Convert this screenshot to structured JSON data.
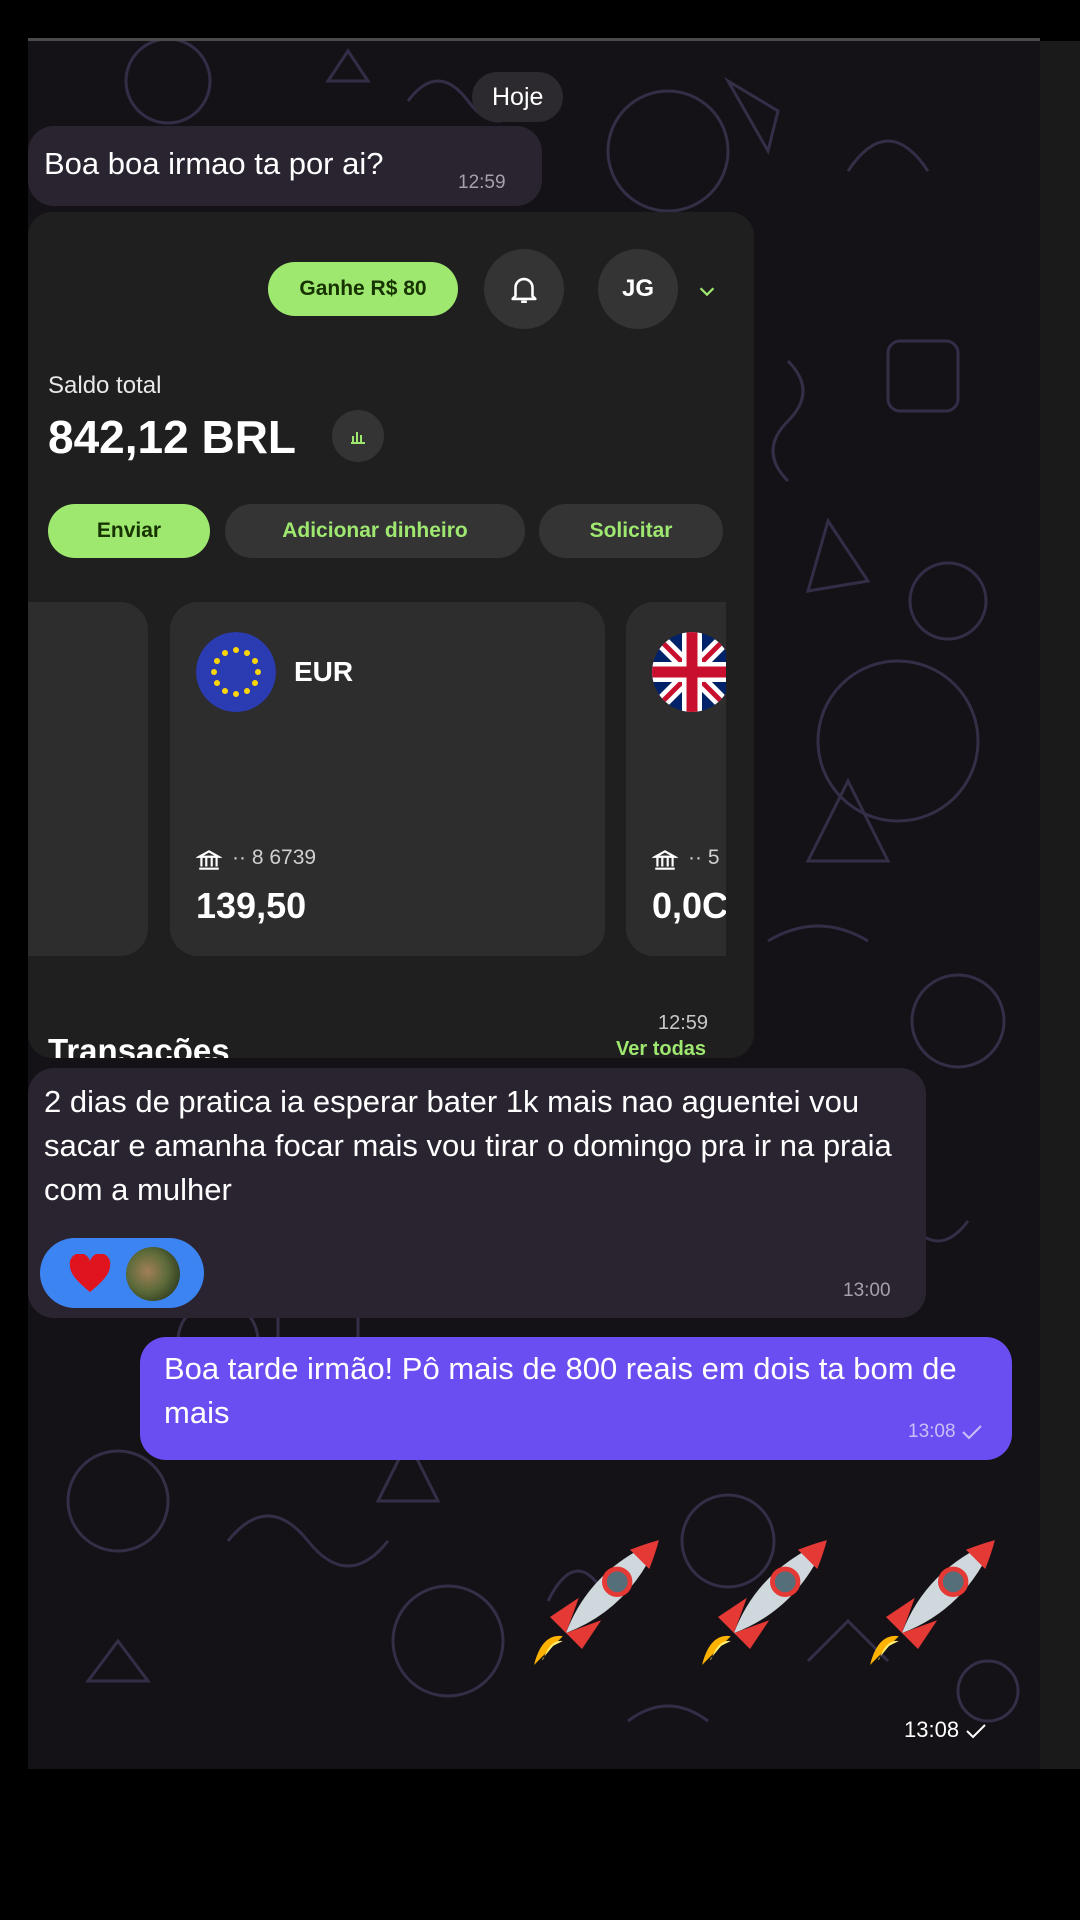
{
  "chat": {
    "date_label": "Hoje",
    "messages": [
      {
        "text": "Boa boa irmao ta por ai?",
        "time": "12:59"
      },
      {
        "text": "2 dias de pratica ia esperar bater 1k mais nao aguentei vou sacar e amanha focar mais vou tirar o domingo pra ir na praia com a mulher",
        "time": "13:00"
      },
      {
        "text": "Boa tarde irmão! Pô mais de 800 reais em dois ta bom de mais",
        "time": "13:08"
      },
      {
        "text": "",
        "time": "13:08"
      }
    ],
    "image_time": "12:59",
    "reactions": [
      "heart-emoji",
      "user-avatar"
    ],
    "emoji_message": [
      "rocket-emoji",
      "rocket-emoji",
      "rocket-emoji"
    ]
  },
  "wallet_screenshot": {
    "earn_button": "Ganhe R$ 80",
    "avatar_initials": "JG",
    "balance_label": "Saldo total",
    "balance_value": "842,12 BRL",
    "actions": {
      "send": "Enviar",
      "add": "Adicionar dinheiro",
      "request": "Solicitar"
    },
    "accounts": [
      {
        "currency": "EUR",
        "account": "·· 8 6739",
        "balance": "139,50"
      },
      {
        "currency": "",
        "account": "·· 5",
        "balance": "0,0C"
      }
    ],
    "transactions_title": "Transações",
    "see_all": "Ver todas"
  },
  "colors": {
    "chat_bg": "#141217",
    "incoming_bubble": "#2a2430",
    "outgoing_bubble": "#6b4ef1",
    "wise_green": "#9fe870",
    "reaction_pill": "#3d84f3"
  }
}
